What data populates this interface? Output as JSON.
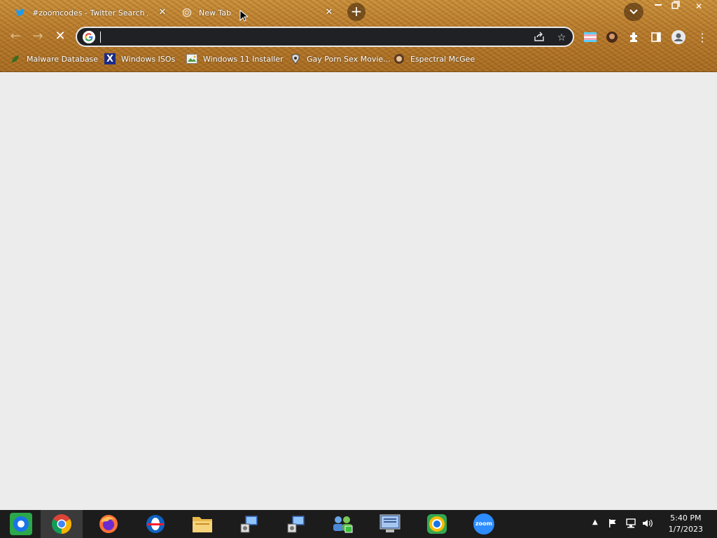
{
  "browser": {
    "tabs": [
      {
        "title": "#zoomcodes - Twitter Search / Twitter",
        "active": false
      },
      {
        "title": "New Tab",
        "active": true
      }
    ],
    "address_bar": {
      "value": "",
      "placeholder": ""
    },
    "bookmarks": [
      {
        "label": "Malware Database",
        "icon": "leaf-icon"
      },
      {
        "label": "Windows ISOs",
        "icon": "x-logo-icon"
      },
      {
        "label": "Windows 11 Installer",
        "icon": "image-icon"
      },
      {
        "label": "Gay Porn Sex Movie...",
        "icon": "game-icon"
      },
      {
        "label": "Espectral McGee",
        "icon": "avatar-icon"
      }
    ]
  },
  "taskbar": {
    "apps": [
      "start",
      "chrome",
      "firefox",
      "opera",
      "file-explorer",
      "installer",
      "installer",
      "network",
      "display",
      "chrome-dev",
      "zoom"
    ],
    "zoom_label": "zoom",
    "clock": {
      "time": "5:40 PM",
      "date": "1/7/2023"
    }
  },
  "colors": {
    "content_bg": "#ececec",
    "omnibox_bg": "#202124",
    "taskbar_bg": "#1c1c1c"
  }
}
